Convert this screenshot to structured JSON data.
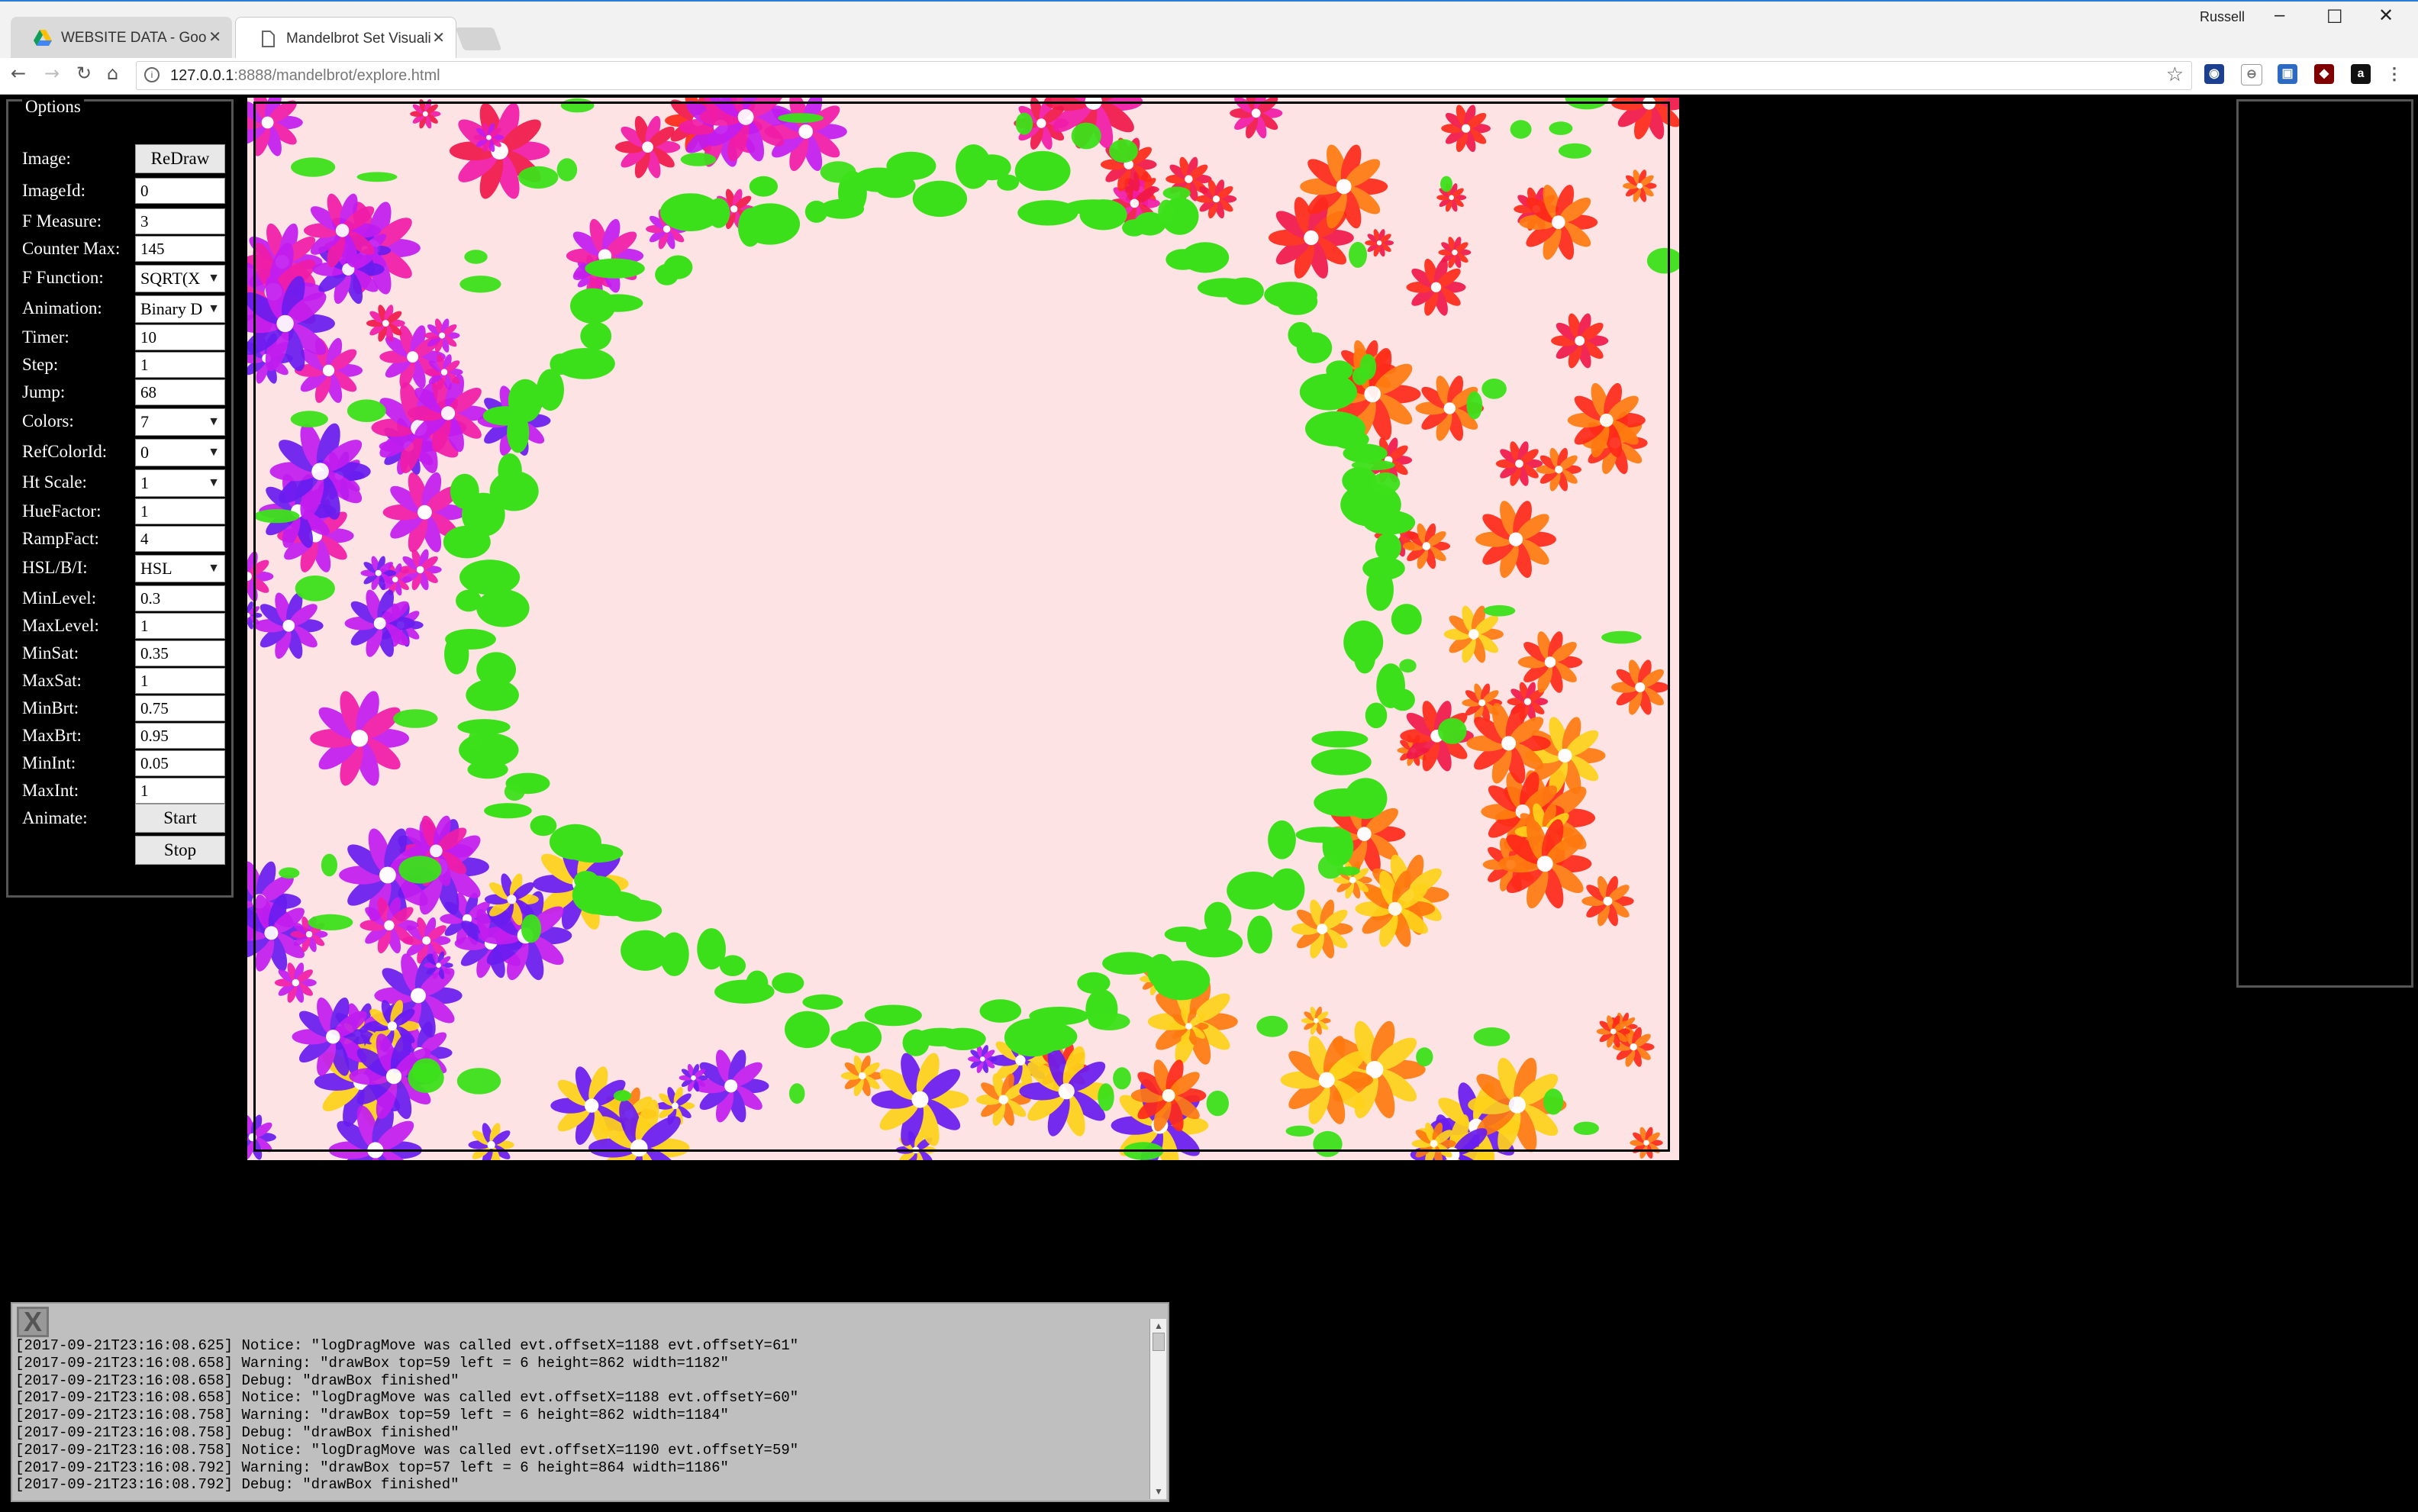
{
  "browser": {
    "tabs": [
      {
        "title": "WEBSITE DATA - Google",
        "active": false,
        "icon": "google-drive-icon"
      },
      {
        "title": "Mandelbrot Set Visualiza",
        "active": true,
        "icon": "page-icon"
      }
    ],
    "profile_name": "Russell",
    "url_host": "127.0.0.1",
    "url_rest": ":8888/mandelbrot/explore.html"
  },
  "options": {
    "legend": "Options",
    "image_label": "Image:",
    "redraw_label": "ReDraw",
    "fields": [
      {
        "label": "ImageId:",
        "value": "0",
        "type": "input"
      },
      {
        "label": "F Measure:",
        "value": "3",
        "type": "input"
      },
      {
        "label": "Counter Max:",
        "value": "145",
        "type": "input"
      },
      {
        "label": "F Function:",
        "value": "SQRT(X",
        "type": "select"
      },
      {
        "label": "Animation:",
        "value": "Binary D",
        "type": "select"
      },
      {
        "label": "Timer:",
        "value": "10",
        "type": "input"
      },
      {
        "label": "Step:",
        "value": "1",
        "type": "input"
      },
      {
        "label": "Jump:",
        "value": "68",
        "type": "input"
      },
      {
        "label": "Colors:",
        "value": "7",
        "type": "select"
      },
      {
        "label": "RefColorId:",
        "value": "0",
        "type": "select"
      },
      {
        "label": "Ht Scale:",
        "value": "1",
        "type": "select"
      },
      {
        "label": "HueFactor:",
        "value": "1",
        "type": "input"
      },
      {
        "label": "RampFact:",
        "value": "4",
        "type": "input"
      },
      {
        "label": "HSL/B/I:",
        "value": "HSL",
        "type": "select"
      },
      {
        "label": "MinLevel:",
        "value": "0.3",
        "type": "input"
      },
      {
        "label": "MaxLevel:",
        "value": "1",
        "type": "input"
      },
      {
        "label": "MinSat:",
        "value": "0.35",
        "type": "input"
      },
      {
        "label": "MaxSat:",
        "value": "1",
        "type": "input"
      },
      {
        "label": "MinBrt:",
        "value": "0.75",
        "type": "input"
      },
      {
        "label": "MaxBrt:",
        "value": "0.95",
        "type": "input"
      },
      {
        "label": "MinInt:",
        "value": "0.05",
        "type": "input"
      },
      {
        "label": "MaxInt:",
        "value": "1",
        "type": "input"
      }
    ],
    "animate_label": "Animate:",
    "start_label": "Start",
    "stop_label": "Stop"
  },
  "canvas": {
    "background": "#fde3e3",
    "palette": [
      "#6a1cf0",
      "#c21cf0",
      "#f01ca8",
      "#f0184a",
      "#ff2a1a",
      "#ff7a10",
      "#ffd21a",
      "#3ce01a"
    ]
  },
  "log": {
    "close_label": "X",
    "lines": [
      "[2017-09-21T23:16:08.625] Notice: \"logDragMove was called evt.offsetX=1188 evt.offsetY=61\"",
      "[2017-09-21T23:16:08.658] Warning: \"drawBox top=59 left = 6 height=862 width=1182\"",
      "[2017-09-21T23:16:08.658] Debug: \"drawBox finished\"",
      "[2017-09-21T23:16:08.658] Notice: \"logDragMove was called evt.offsetX=1188 evt.offsetY=60\"",
      "[2017-09-21T23:16:08.758] Warning: \"drawBox top=59 left = 6 height=862 width=1184\"",
      "[2017-09-21T23:16:08.758] Debug: \"drawBox finished\"",
      "[2017-09-21T23:16:08.758] Notice: \"logDragMove was called evt.offsetX=1190 evt.offsetY=59\"",
      "[2017-09-21T23:16:08.792] Warning: \"drawBox top=57 left = 6 height=864 width=1186\"",
      "[2017-09-21T23:16:08.792] Debug: \"drawBox finished\""
    ]
  }
}
